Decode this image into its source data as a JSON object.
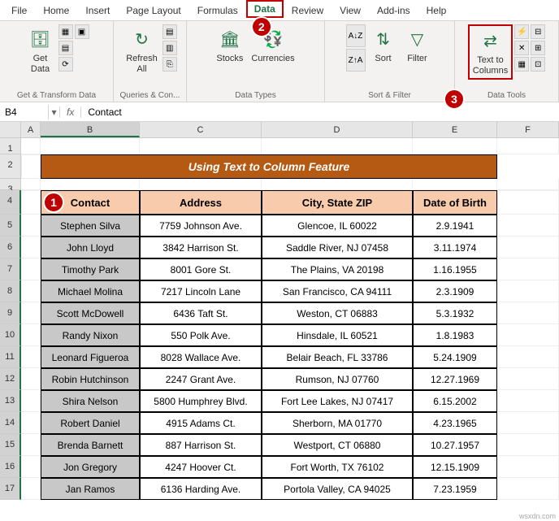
{
  "menu": {
    "items": [
      "File",
      "Home",
      "Insert",
      "Page Layout",
      "Formulas",
      "Data",
      "Review",
      "View",
      "Add-ins",
      "Help"
    ],
    "active": "Data"
  },
  "callouts": {
    "c1": "1",
    "c2": "2",
    "c3": "3"
  },
  "ribbon": {
    "groups": [
      {
        "label": "Get & Transform Data",
        "buttons": [
          {
            "icon": "⬚",
            "label": "Get\nData"
          }
        ],
        "small": [
          "▦",
          "▤",
          "⟳",
          "▣"
        ]
      },
      {
        "label": "Queries & Con...",
        "buttons": [
          {
            "icon": "↻",
            "label": "Refresh\nAll"
          }
        ],
        "small": [
          "▤",
          "▥",
          "⎘"
        ]
      },
      {
        "label": "Data Types",
        "buttons": [
          {
            "icon": "🏛",
            "label": "Stocks"
          },
          {
            "icon": "¤",
            "label": "Currencies"
          }
        ]
      },
      {
        "label": "Sort & Filter",
        "buttons": [
          {
            "icon": "A↓Z",
            "label": ""
          },
          {
            "icon": "Z↓A",
            "label": "Sort"
          },
          {
            "icon": "▽",
            "label": "Filter"
          }
        ]
      },
      {
        "label": "Data Tools",
        "buttons": [
          {
            "icon": "⇄",
            "label": "Text to\nColumns",
            "boxed": true
          }
        ],
        "small": [
          "⚡",
          "✕",
          "▦",
          "⊟",
          "⊞",
          "⊡"
        ]
      }
    ]
  },
  "formula_bar": {
    "name_box": "B4",
    "fx": "fx",
    "value": "Contact"
  },
  "columns": [
    "A",
    "B",
    "C",
    "D",
    "E",
    "F"
  ],
  "sheet": {
    "title": "Using Text to Column Feature",
    "headers": [
      "Contact",
      "Address",
      "City, State ZIP",
      "Date of Birth"
    ],
    "rows": [
      {
        "name": "Stephen Silva",
        "addr": "7759 Johnson Ave.",
        "csz": "Glencoe, IL   60022",
        "dob": "2.9.1941"
      },
      {
        "name": "John Lloyd",
        "addr": "3842 Harrison St.",
        "csz": "Saddle River, NJ 07458",
        "dob": "3.11.1974"
      },
      {
        "name": "Timothy Park",
        "addr": "8001 Gore St.",
        "csz": "The Plains, VA   20198",
        "dob": "1.16.1955"
      },
      {
        "name": "Michael Molina",
        "addr": "7217 Lincoln Lane",
        "csz": "San Francisco, CA   94111",
        "dob": "2.3.1909"
      },
      {
        "name": "Scott McDowell",
        "addr": "6436 Taft St.",
        "csz": "Weston, CT   06883",
        "dob": "5.3.1932"
      },
      {
        "name": "Randy Nixon",
        "addr": "550 Polk Ave.",
        "csz": "Hinsdale, IL   60521",
        "dob": "1.8.1983"
      },
      {
        "name": "Leonard Figueroa",
        "addr": "8028 Wallace Ave.",
        "csz": "Belair Beach, FL   33786",
        "dob": "5.24.1909"
      },
      {
        "name": "Robin Hutchinson",
        "addr": "2247 Grant Ave.",
        "csz": "Rumson, NJ   07760",
        "dob": "12.27.1969"
      },
      {
        "name": "Shira Nelson",
        "addr": "5800 Humphrey Blvd.",
        "csz": "Fort Lee Lakes, NJ   07417",
        "dob": "6.15.2002"
      },
      {
        "name": "Robert Daniel",
        "addr": "4915 Adams Ct.",
        "csz": "Sherborn, MA   01770",
        "dob": "4.23.1965"
      },
      {
        "name": "Brenda Barnett",
        "addr": "887 Harrison St.",
        "csz": "Westport, CT   06880",
        "dob": "10.27.1957"
      },
      {
        "name": "Jon Gregory",
        "addr": "4247 Hoover Ct.",
        "csz": "Fort Worth, TX   76102",
        "dob": "12.15.1909"
      },
      {
        "name": "Jan Ramos",
        "addr": "6136 Harding Ave.",
        "csz": "Portola Valley, CA   94025",
        "dob": "7.23.1959"
      }
    ]
  },
  "watermark": "wsxdn.com"
}
